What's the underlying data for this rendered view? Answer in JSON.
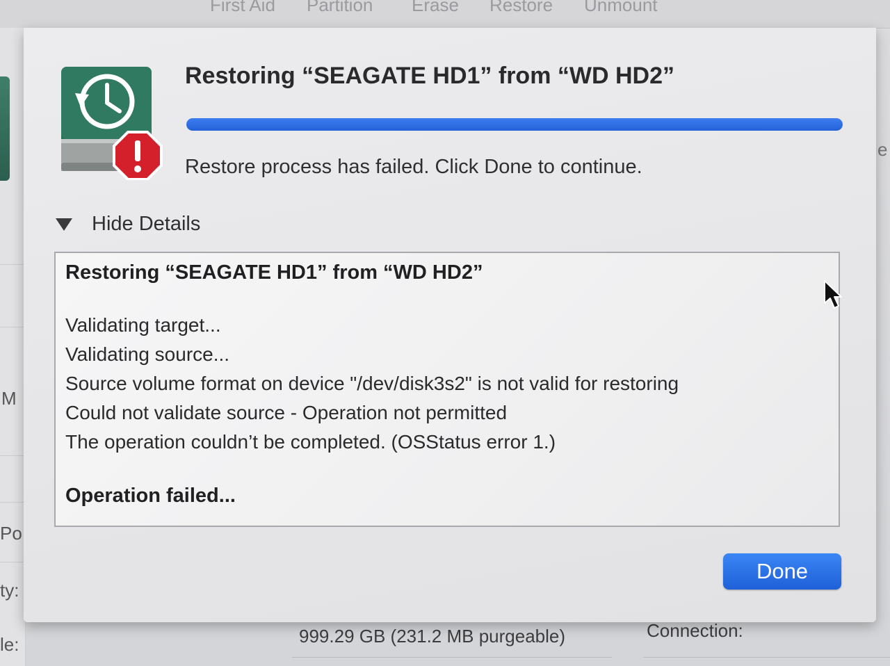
{
  "toolbar": {
    "items": [
      "First Aid",
      "Partition",
      "Erase",
      "Restore",
      "Unmount"
    ]
  },
  "background": {
    "left_labels": [
      "M",
      "Po",
      "ty:",
      "le:"
    ],
    "right_fragment": "e",
    "bottom_capacity": "999.29 GB (231.2 MB purgeable)",
    "bottom_connection": "Connection:"
  },
  "dialog": {
    "title": "Restoring “SEAGATE HD1” from “WD HD2”",
    "progress_fraction": 1.0,
    "status_message": "Restore process has failed. Click Done to continue.",
    "details_toggle_label": "Hide Details",
    "details": {
      "heading": "Restoring “SEAGATE HD1” from “WD HD2”",
      "log_lines": [
        "Validating target...",
        "Validating source...",
        "Source volume format on device \"/dev/disk3s2\" is not valid for restoring",
        "Could not validate source - Operation not permitted",
        "The operation couldn’t be completed. (OSStatus error 1.)"
      ],
      "footer": "Operation failed..."
    },
    "done_label": "Done",
    "icon": "disk-utility-restore-error-icon",
    "colors": {
      "accent": "#2461d8",
      "icon_green": "#2e6e58",
      "error_red": "#d3202a"
    }
  }
}
